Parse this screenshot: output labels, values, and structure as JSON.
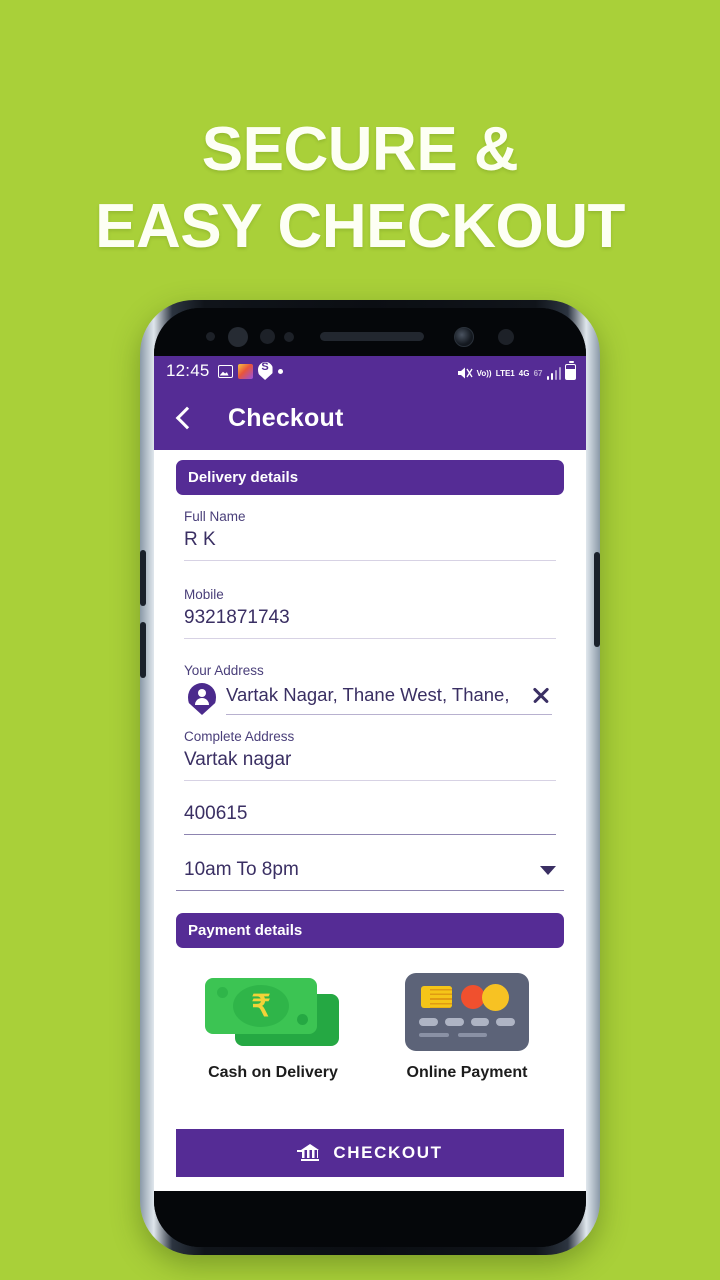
{
  "promo": {
    "line1": "SECURE &",
    "line2": "EASY CHECKOUT"
  },
  "colors": {
    "background": "#a9d039",
    "primary_purple": "#552c95",
    "promo_text": "#fdfff4",
    "cash_green": "#3cc453",
    "card_slate": "#5c6378"
  },
  "statusbar": {
    "time": "12:45",
    "left_icons": [
      "image-icon",
      "app-icon",
      "swiggy-pin-icon",
      "dot-icon"
    ],
    "volte_label": "Vo))",
    "volte_sub": "LTE1",
    "network": "4G",
    "network_sub": "67",
    "right_icons": [
      "mute-icon",
      "volte-icon",
      "signal-icon",
      "battery-icon"
    ]
  },
  "appbar": {
    "back_icon": "back-chevron-icon",
    "title": "Checkout"
  },
  "delivery": {
    "section_title": "Delivery details",
    "fields": [
      {
        "label": "Full Name",
        "value": "R K"
      },
      {
        "label": "Mobile",
        "value": "9321871743"
      }
    ],
    "address": {
      "label": "Your Address",
      "value": "Vartak Nagar, Thane West, Thane,",
      "pin_icon": "location-person-pin-icon",
      "clear_icon": "close-icon"
    },
    "complete_address": {
      "label": "Complete Address",
      "value": "Vartak nagar"
    },
    "pincode": {
      "value": "400615"
    },
    "time_slot": {
      "value": "10am To 8pm",
      "caret_icon": "chevron-down-icon"
    }
  },
  "payment": {
    "section_title": "Payment details",
    "options": [
      {
        "label": "Cash on Delivery",
        "icon": "cash-rupee-icon",
        "currency_symbol": "₹"
      },
      {
        "label": "Online Payment",
        "icon": "credit-card-icon"
      }
    ]
  },
  "checkout": {
    "label": "CHECKOUT",
    "icon": "bank-transfer-icon"
  }
}
